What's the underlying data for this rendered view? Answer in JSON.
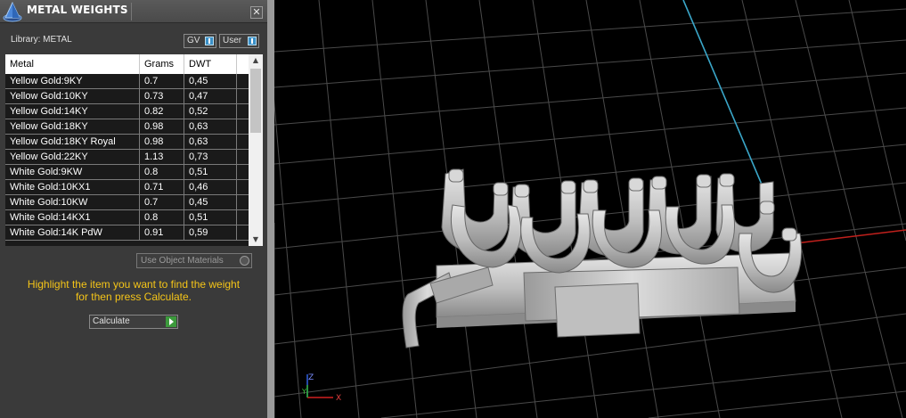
{
  "window": {
    "title": "METAL WEIGHTS",
    "close_glyph": "✕",
    "icon": "app-logo-icon"
  },
  "library": {
    "label": "Library: METAL"
  },
  "toggles": {
    "gv": "GV",
    "user": "User"
  },
  "table": {
    "columns": [
      "Metal",
      "Grams",
      "DWT"
    ],
    "rows": [
      {
        "metal": "Yellow Gold:9KY",
        "grams": "0.7",
        "dwt": "0,45"
      },
      {
        "metal": "Yellow Gold:10KY",
        "grams": "0.73",
        "dwt": "0,47"
      },
      {
        "metal": "Yellow Gold:14KY",
        "grams": "0.82",
        "dwt": "0,52"
      },
      {
        "metal": "Yellow Gold:18KY",
        "grams": "0.98",
        "dwt": "0,63"
      },
      {
        "metal": "Yellow Gold:18KY Royal",
        "grams": "0.98",
        "dwt": "0,63"
      },
      {
        "metal": "Yellow Gold:22KY",
        "grams": "1.13",
        "dwt": "0,73"
      },
      {
        "metal": "White Gold:9KW",
        "grams": "0.8",
        "dwt": "0,51"
      },
      {
        "metal": "White Gold:10KX1",
        "grams": "0.71",
        "dwt": "0,46"
      },
      {
        "metal": "White Gold:10KW",
        "grams": "0.7",
        "dwt": "0,45"
      },
      {
        "metal": "White Gold:14KX1",
        "grams": "0.8",
        "dwt": "0,51"
      },
      {
        "metal": "White Gold:14K PdW",
        "grams": "0.91",
        "dwt": "0,59"
      }
    ]
  },
  "options": {
    "use_object_materials": "Use Object Materials"
  },
  "hint": {
    "line1": "Highlight the item you want to find the weight",
    "line2": "for then press Calculate."
  },
  "actions": {
    "calculate": "Calculate"
  },
  "axes": {
    "z": "Z",
    "y": "Y",
    "x": "X"
  },
  "colors": {
    "hint": "#f5c518",
    "y_axis": "#3aa6c8",
    "x_axis": "#c0201c"
  }
}
